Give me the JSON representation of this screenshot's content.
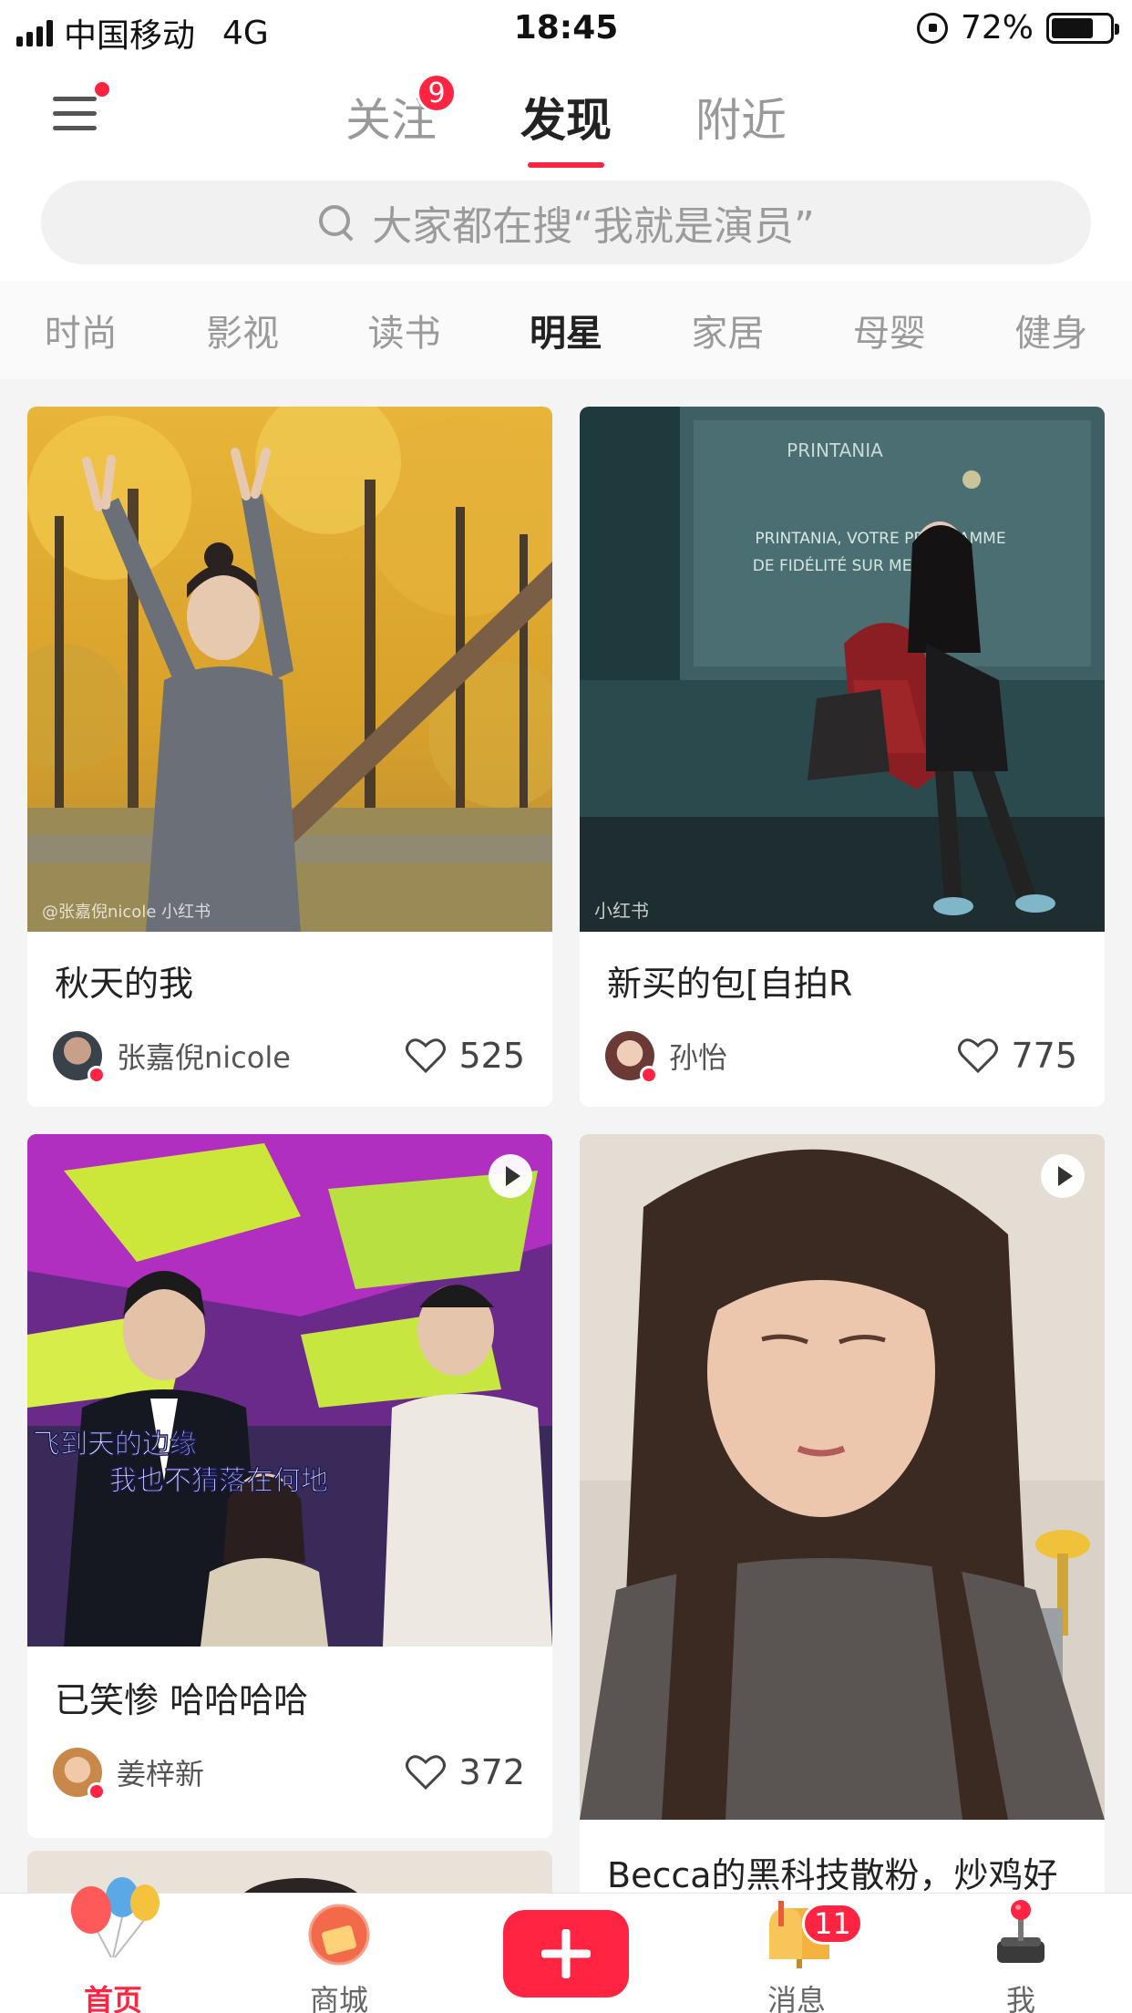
{
  "status_bar": {
    "carrier": "中国移动",
    "network": "4G",
    "time": "18:45",
    "battery": "72%",
    "battery_level": 0.72
  },
  "header": {
    "menu_has_dot": true,
    "tabs": [
      {
        "label": "关注",
        "badge": "9",
        "active": false
      },
      {
        "label": "发现",
        "active": true
      },
      {
        "label": "附近",
        "active": false
      }
    ],
    "search_placeholder": "大家都在搜“我就是演员”"
  },
  "categories": [
    {
      "label": "时尚",
      "active": false
    },
    {
      "label": "影视",
      "active": false
    },
    {
      "label": "读书",
      "active": false
    },
    {
      "label": "明星",
      "active": true
    },
    {
      "label": "家居",
      "active": false
    },
    {
      "label": "母婴",
      "active": false
    },
    {
      "label": "健身",
      "active": false
    }
  ],
  "feed": {
    "cards": [
      {
        "title": "秋天的我",
        "author": "张嘉倪nicole",
        "likes": "525",
        "is_video": false,
        "watermark": "@张嘉倪nicole 小红书"
      },
      {
        "title": "新买的包[自拍R",
        "author": "孙怡",
        "likes": "775",
        "is_video": false,
        "watermark": "小红书",
        "sign_line1": "PRINTANIA",
        "sign_line2": "PRINTANIA, VOTRE PROGRAMME",
        "sign_line3": "DE FIDÉLITÉ SUR MESURE"
      },
      {
        "title": "已笑惨 哈哈哈哈",
        "author": "姜梓新",
        "likes": "372",
        "is_video": true,
        "subtitle_line1": "飞到天的边缘",
        "subtitle_line2": "我也不猜落在何地"
      },
      {
        "title": "Becca的黑科技散粉，炒鸡好",
        "is_video": true
      }
    ]
  },
  "bottom_nav": {
    "items": [
      {
        "label": "首页",
        "active": true
      },
      {
        "label": "商城",
        "active": false
      },
      {
        "label": "消息",
        "badge": "11",
        "active": false
      },
      {
        "label": "我",
        "active": false
      }
    ]
  },
  "colors": {
    "accent": "#ff2442",
    "text_primary": "#222222",
    "text_secondary": "#999999"
  }
}
